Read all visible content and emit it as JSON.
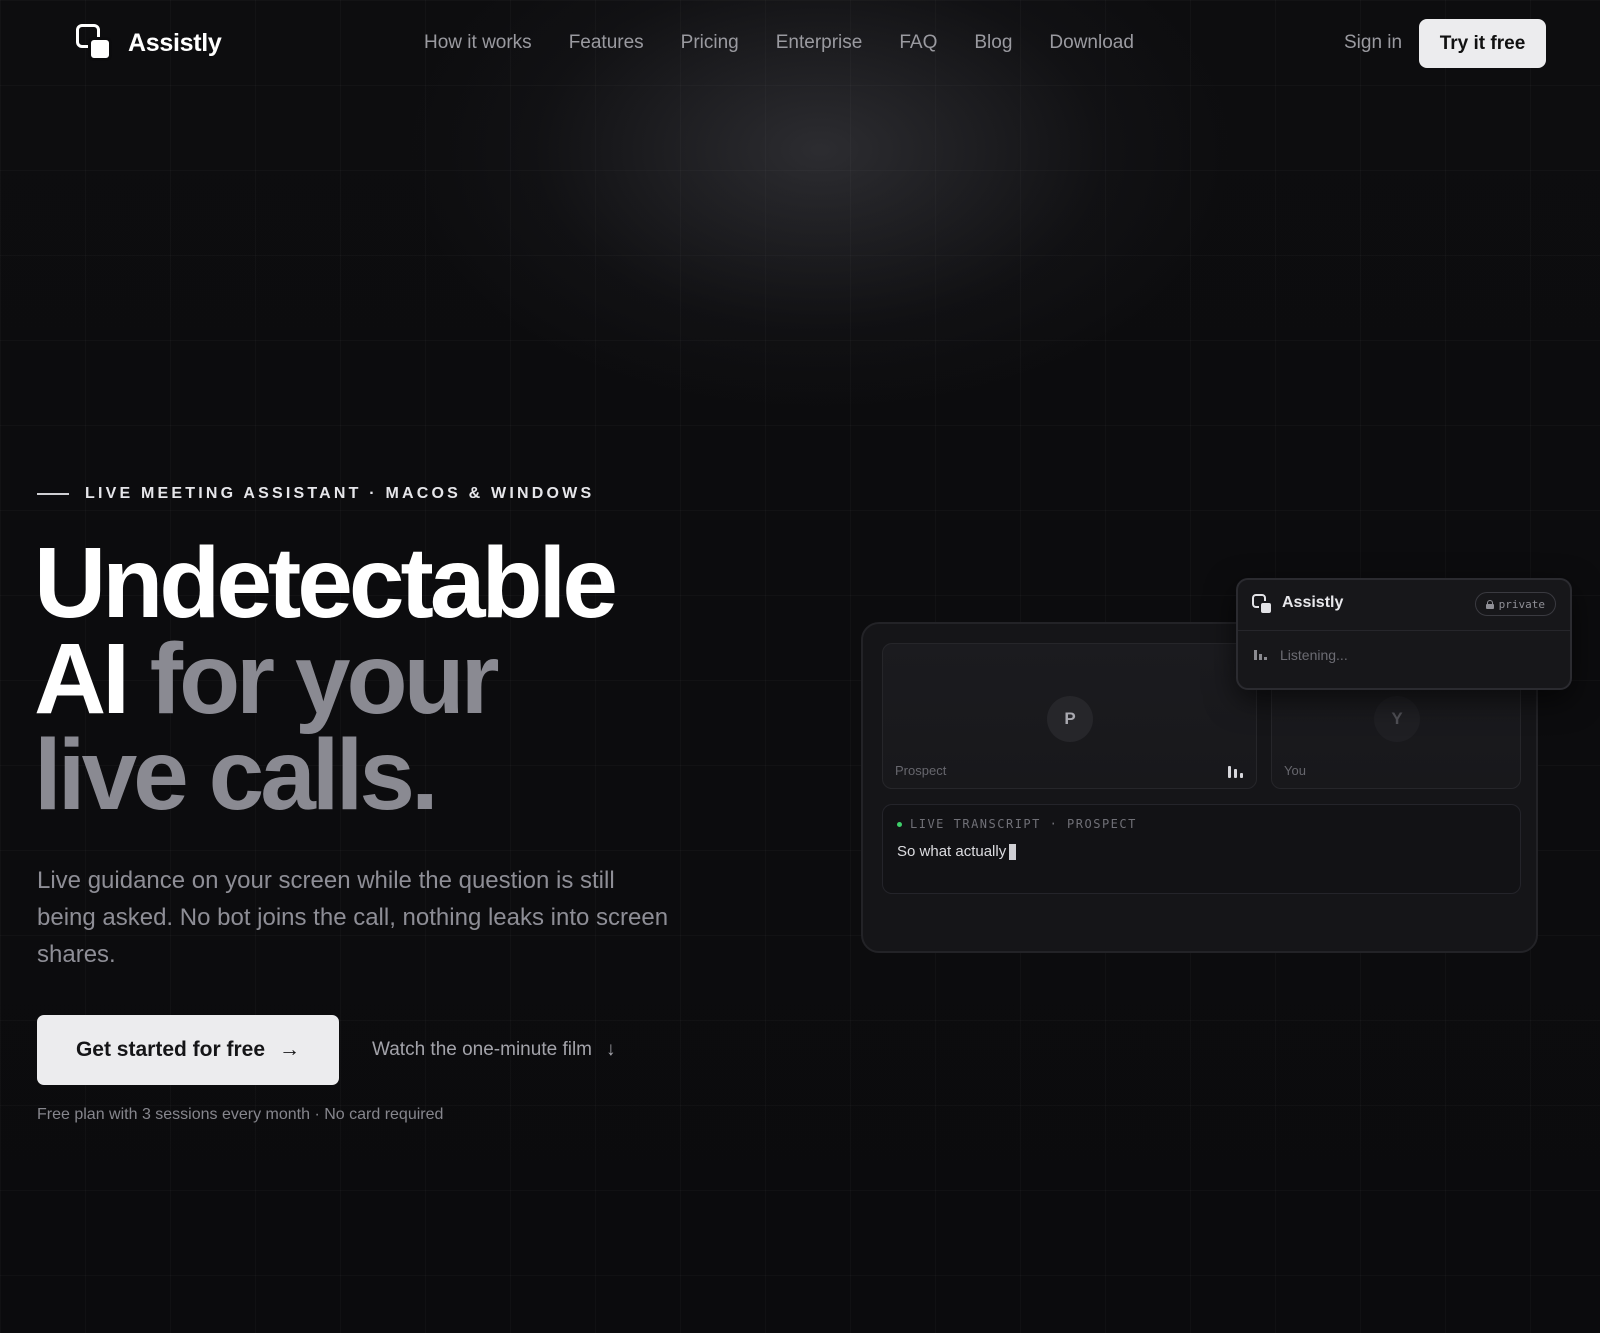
{
  "brand": {
    "name": "Assistly"
  },
  "nav": {
    "links": [
      "How it works",
      "Features",
      "Pricing",
      "Enterprise",
      "FAQ",
      "Blog",
      "Download"
    ],
    "signin": "Sign in",
    "cta": "Try it free"
  },
  "hero": {
    "eyebrow": "LIVE MEETING ASSISTANT · MACOS & WINDOWS",
    "headline": {
      "line1": "Undetectable",
      "line2_white": "AI",
      "line2_gray": "for your",
      "line3_gray": "live calls."
    },
    "lead": "Live guidance on your screen while the question is still being asked. No bot joins the call, nothing leaks into screen shares.",
    "cta_primary": "Get started for free",
    "cta_primary_icon": "→",
    "cta_secondary": "Watch the one-minute film",
    "cta_secondary_icon": "↓",
    "fineprint": "Free plan with 3 sessions every month · No card required"
  },
  "mockup": {
    "tiles": [
      {
        "initial": "P",
        "label": "Prospect"
      },
      {
        "initial": "Y",
        "label": "You"
      }
    ],
    "transcript": {
      "header": "LIVE TRANSCRIPT · PROSPECT",
      "text": "So what actually"
    },
    "overlay": {
      "title": "Assistly",
      "badge": "private",
      "status": "Listening..."
    }
  },
  "colors": {
    "background": "#0b0b0d",
    "accent_button": "#ececee",
    "headline_gray": "#8a8a92",
    "live_dot": "#3ecf6a"
  }
}
